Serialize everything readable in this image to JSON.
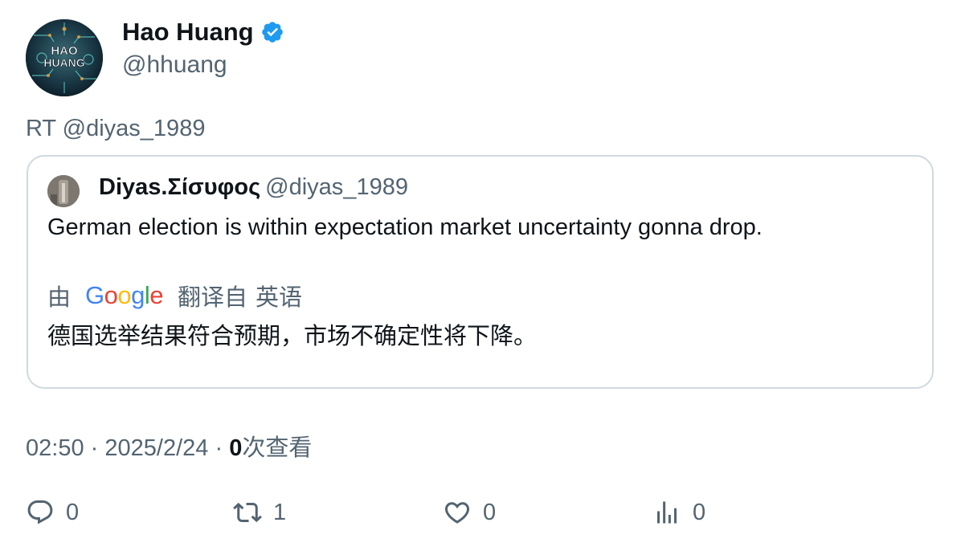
{
  "author": {
    "display_name": "Hao Huang",
    "handle": "@hhuang",
    "avatar_text": "HAO HUANG",
    "verified_color": "#1d9bf0"
  },
  "retweet_label": "RT @diyas_1989",
  "quoted": {
    "display_name": "Diyas.Σίσυφος",
    "handle": "@diyas_1989",
    "text": "German election is within expectation market uncertainty gonna drop.",
    "translate_prefix": "由",
    "translate_provider": "Google",
    "translate_suffix": "翻译自",
    "translate_language": "英语",
    "translated_text": "德国选举结果符合预期，市场不确定性将下降。"
  },
  "meta": {
    "time": "02:50",
    "separator": "·",
    "date": "2025/2/24",
    "views_count": "0",
    "views_label": "次查看"
  },
  "actions": {
    "replies": "0",
    "retweets": "1",
    "likes": "0",
    "views": "0"
  },
  "colors": {
    "text": "#0f1419",
    "secondary": "#536471",
    "border": "#cfd9de",
    "accent": "#1d9bf0"
  }
}
